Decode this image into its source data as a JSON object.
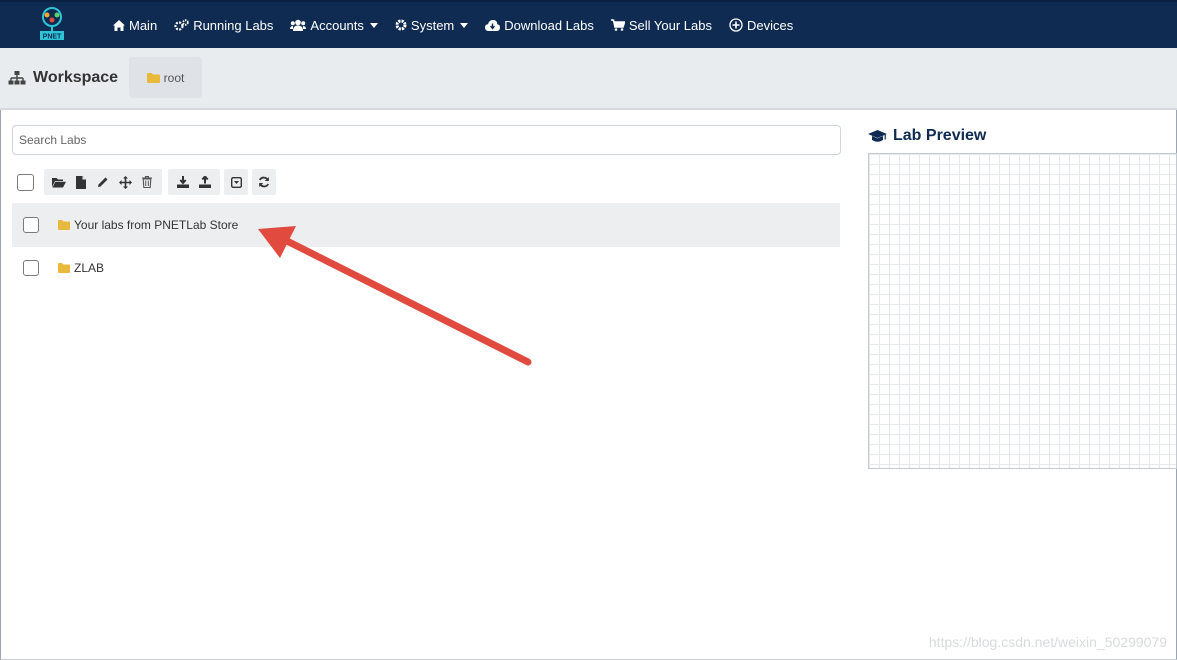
{
  "navbar": {
    "logo_text": "PNET",
    "items": [
      {
        "label": "Main",
        "icon": "home-icon"
      },
      {
        "label": "Running Labs",
        "icon": "gears-icon"
      },
      {
        "label": "Accounts",
        "icon": "users-icon",
        "dropdown": true
      },
      {
        "label": "System",
        "icon": "gear-icon",
        "dropdown": true
      },
      {
        "label": "Download Labs",
        "icon": "cloud-download-icon"
      },
      {
        "label": "Sell Your Labs",
        "icon": "cart-icon"
      },
      {
        "label": "Devices",
        "icon": "plus-circle-icon"
      }
    ]
  },
  "breadcrumb": {
    "title": "Workspace",
    "root_label": "root"
  },
  "search": {
    "placeholder": "Search Labs"
  },
  "toolbar": {
    "buttons": [
      "open-folder-icon",
      "new-file-icon",
      "edit-icon",
      "move-icon",
      "delete-icon",
      "import-icon",
      "export-icon",
      "collapse-icon",
      "refresh-icon"
    ]
  },
  "labs": [
    {
      "name": "Your labs from PNETLab Store",
      "type": "folder"
    },
    {
      "name": "ZLAB",
      "type": "folder"
    }
  ],
  "preview": {
    "title": "Lab Preview"
  },
  "watermark": "https://blog.csdn.net/weixin_50299079",
  "colors": {
    "navbar_bg": "#0f2b52",
    "folder": "#e8b93a",
    "arrow": "#e04a3f",
    "crumb_bg": "#e9ecef"
  }
}
